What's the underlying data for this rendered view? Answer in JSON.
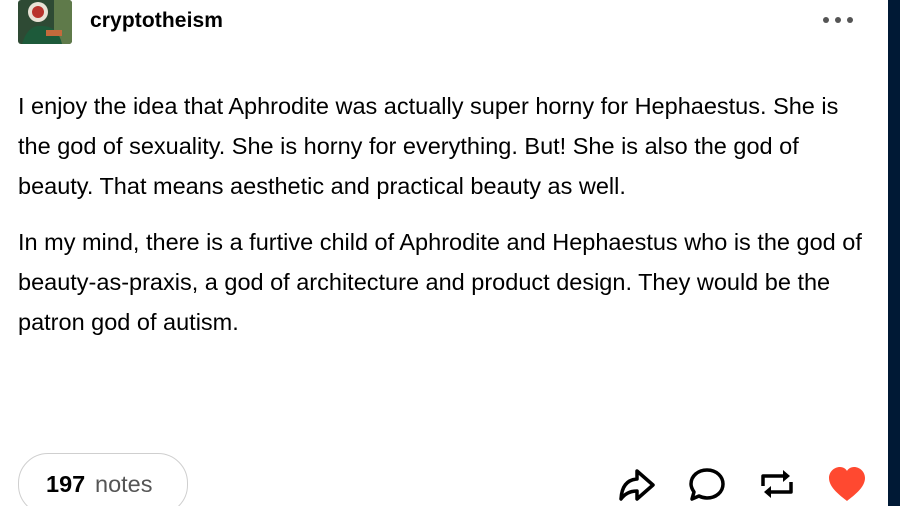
{
  "post": {
    "username": "cryptotheism",
    "paragraphs": [
      "I enjoy the idea that Aphrodite was actually super horny for Hephaestus. She is the god of sexuality. She is horny for everything. But! She is also the god of beauty. That means aesthetic and practical beauty as well.",
      "In my mind, there is a furtive child of Aphrodite and Hephaestus who is the god of beauty-as-praxis, a god of architecture and product design. They would be the patron god of autism."
    ],
    "notes_count": "197",
    "notes_label": "notes"
  },
  "icons": {
    "more": "more-dots-icon",
    "share": "share-arrow-icon",
    "reply": "reply-bubble-icon",
    "reblog": "reblog-icon",
    "like": "heart-icon"
  },
  "colors": {
    "page_background": "#001935",
    "card": "#ffffff",
    "like": "#ff4930",
    "icon": "#000000"
  }
}
